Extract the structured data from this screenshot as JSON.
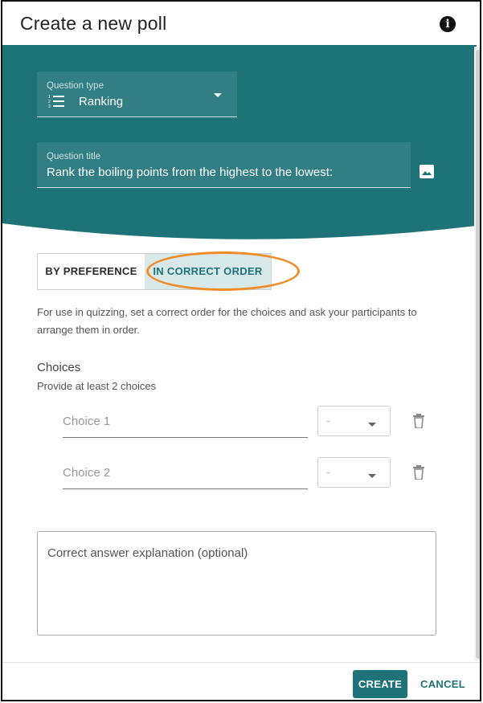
{
  "dialog": {
    "title": "Create a new poll",
    "info_icon": "info-icon",
    "accent_color": "#1d7377",
    "highlight_color": "#f28c28"
  },
  "question_type": {
    "label": "Question type",
    "value": "Ranking",
    "icon": "ranking-list-icon"
  },
  "question_title": {
    "label": "Question title",
    "value": "Rank the boiling points from the highest to the lowest:",
    "image_icon": "image-icon"
  },
  "ranking_mode": {
    "options": [
      "BY PREFERENCE",
      "IN CORRECT ORDER"
    ],
    "selected": "IN CORRECT ORDER"
  },
  "description": "For use in quizzing, set a correct order for the choices and ask your participants to arrange them in order.",
  "choices": {
    "heading": "Choices",
    "subtext": "Provide at least 2 choices",
    "items": [
      {
        "placeholder": "Choice 1",
        "order": "-"
      },
      {
        "placeholder": "Choice 2",
        "order": "-"
      }
    ]
  },
  "explanation": {
    "placeholder": "Correct answer explanation (optional)"
  },
  "footer": {
    "create_label": "CREATE",
    "cancel_label": "CANCEL"
  }
}
